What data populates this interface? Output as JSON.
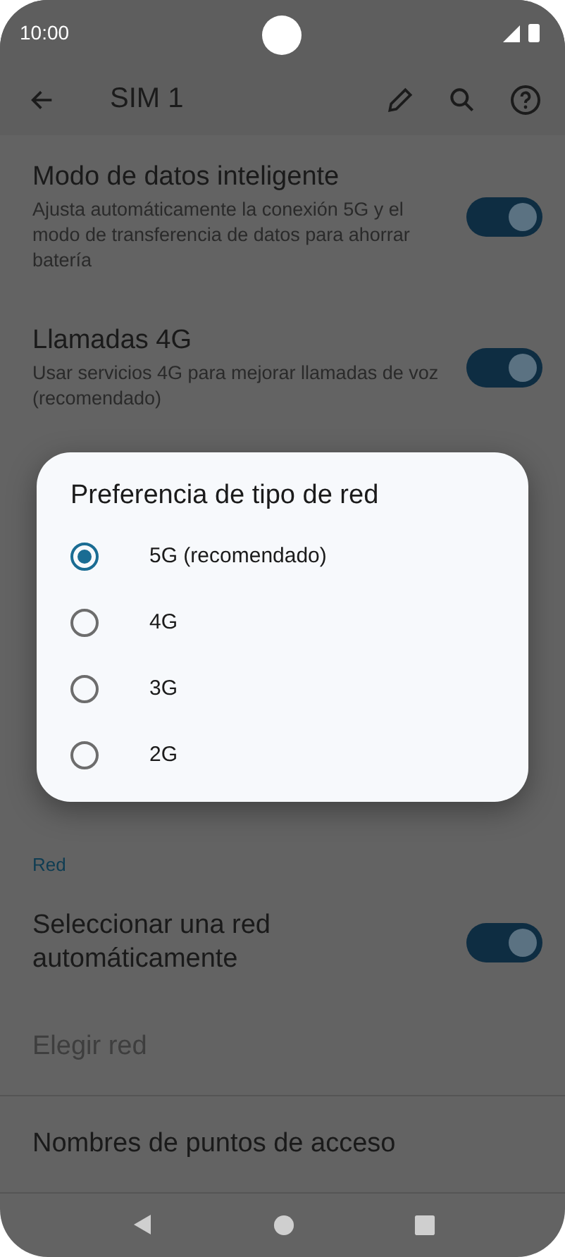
{
  "status_bar": {
    "time": "10:00"
  },
  "app_bar": {
    "title": "SIM 1"
  },
  "settings": [
    {
      "kind": "switch",
      "title": "Modo de datos inteligente",
      "summary": "Ajusta automáticamente la conexión 5G y el modo de transferencia de datos para ahorrar batería",
      "on": true
    },
    {
      "kind": "switch",
      "title": "Llamadas 4G",
      "summary": "Usar servicios 4G para mejorar llamadas de voz (recomendado)",
      "on": true
    }
  ],
  "network_section": {
    "header": "Red",
    "items": [
      {
        "kind": "switch",
        "title": "Seleccionar una red automáticamente",
        "on": true,
        "disabled": false
      },
      {
        "kind": "plain",
        "title": "Elegir red",
        "disabled": true
      },
      {
        "kind": "plain",
        "title": "Nombres de puntos de acceso",
        "disabled": false
      }
    ]
  },
  "dialog": {
    "title": "Preferencia de tipo de red",
    "options": [
      {
        "label": "5G (recomendado)",
        "selected": true
      },
      {
        "label": "4G",
        "selected": false
      },
      {
        "label": "3G",
        "selected": false
      },
      {
        "label": "2G",
        "selected": false
      }
    ]
  }
}
